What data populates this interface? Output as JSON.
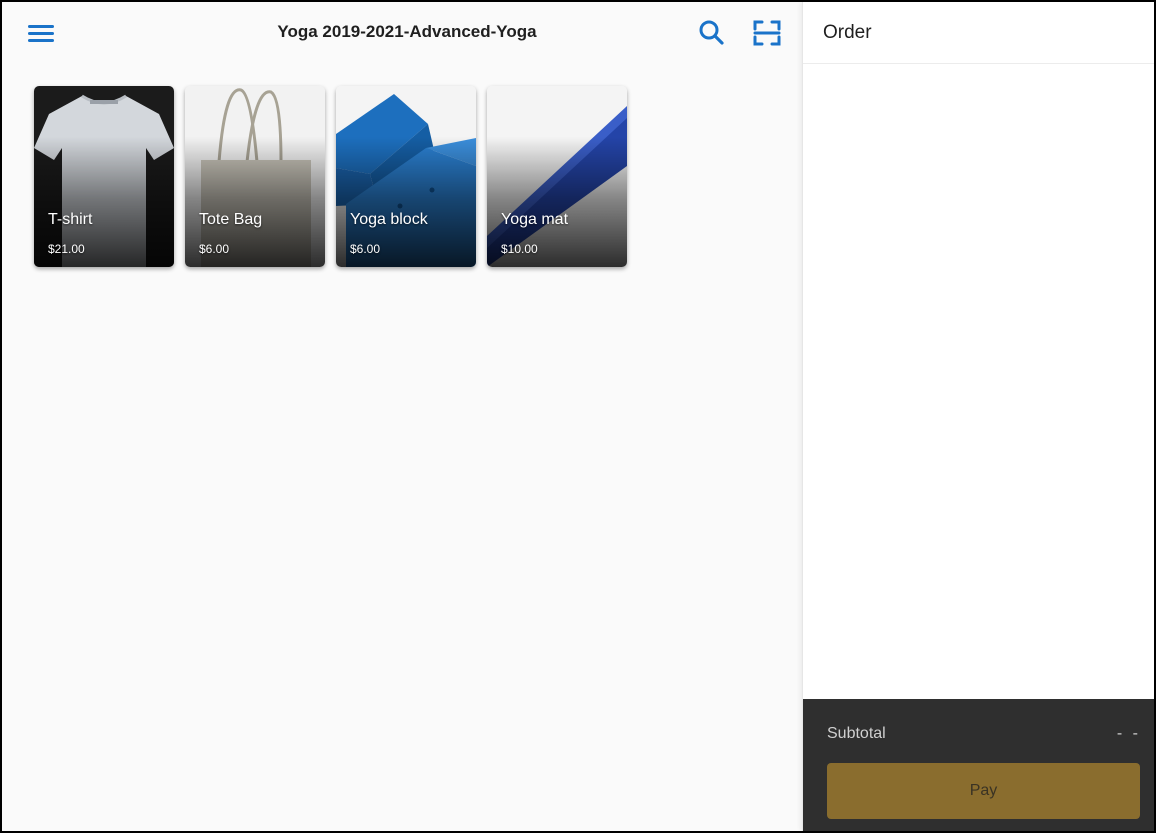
{
  "header": {
    "store_title": "Yoga 2019-2021-Advanced-Yoga"
  },
  "icons": {
    "menu": "hamburger-icon",
    "search": "search-icon",
    "scan": "barcode-scan-icon"
  },
  "products": [
    {
      "name": "T-shirt",
      "price": "$21.00",
      "image": "tshirt"
    },
    {
      "name": "Tote Bag",
      "price": "$6.00",
      "image": "tote-bag"
    },
    {
      "name": "Yoga block",
      "price": "$6.00",
      "image": "yoga-block"
    },
    {
      "name": "Yoga mat",
      "price": "$10.00",
      "image": "yoga-mat"
    }
  ],
  "order": {
    "title": "Order",
    "subtotal_label": "Subtotal",
    "subtotal_value": "- -",
    "pay_label": "Pay"
  },
  "colors": {
    "accent": "#1a73c9",
    "pay_button": "#8a6d2e",
    "checkout_bg": "#2f2f2f"
  }
}
